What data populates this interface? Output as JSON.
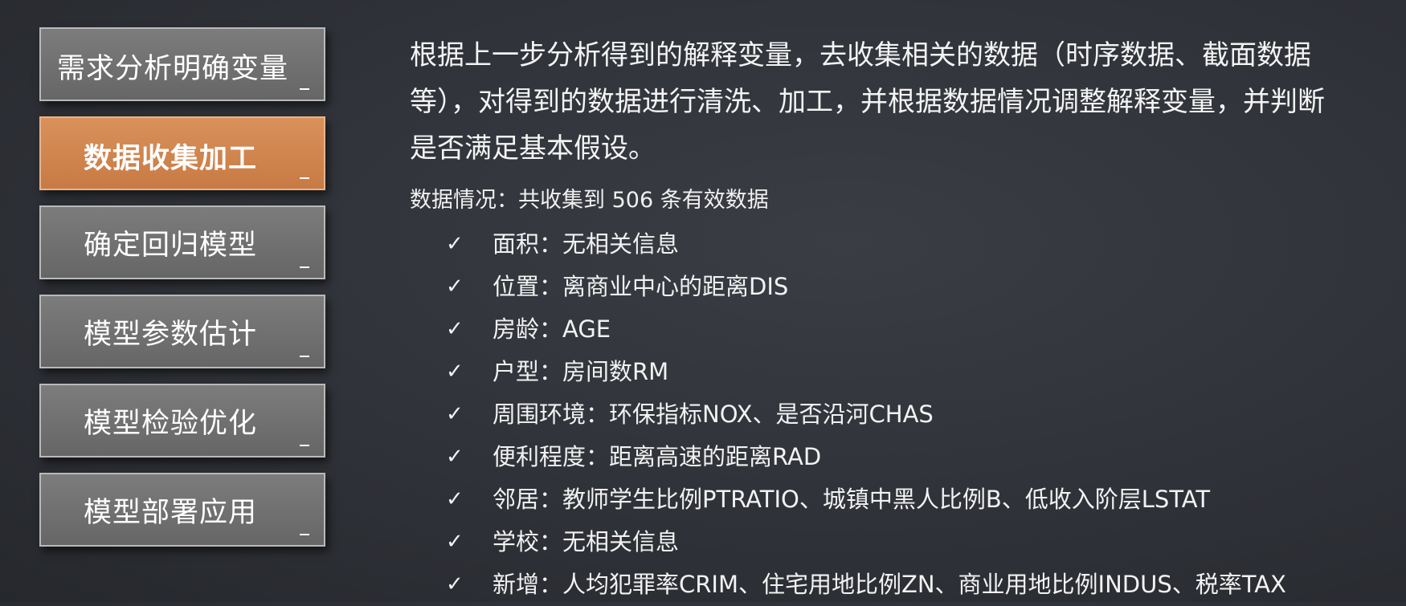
{
  "steps": [
    {
      "label": "需求分析明确变量"
    },
    {
      "label": "数据收集加工"
    },
    {
      "label": "确定回归模型"
    },
    {
      "label": "模型参数估计"
    },
    {
      "label": "模型检验优化"
    },
    {
      "label": "模型部署应用"
    }
  ],
  "active_step": 1,
  "accent_color": "#d08650",
  "content": {
    "intro": "根据上一步分析得到的解释变量，去收集相关的数据（时序数据、截面数据等），对得到的数据进行清洗、加工，并根据数据情况调整解释变量，并判断是否满足基本假设。",
    "summary": "数据情况：共收集到 506 条有效数据",
    "check_symbol": "✓",
    "items": [
      "面积：无相关信息",
      "位置：离商业中心的距离DIS",
      "房龄：AGE",
      "户型：房间数RM",
      "周围环境：环保指标NOX、是否沿河CHAS",
      "便利程度：距离高速的距离RAD",
      "邻居：教师学生比例PTRATIO、城镇中黑人比例B、低收入阶层LSTAT",
      "学校：无相关信息",
      "新增：人均犯罪率CRIM、住宅用地比例ZN、商业用地比例INDUS、税率TAX"
    ]
  }
}
